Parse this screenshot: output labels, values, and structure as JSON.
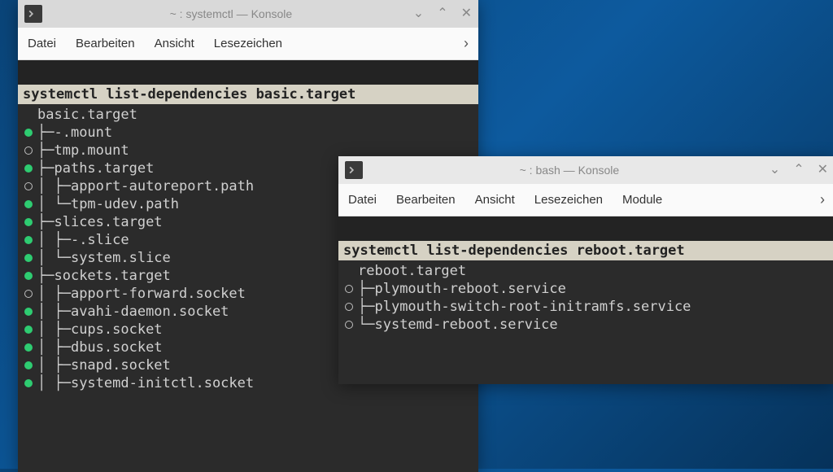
{
  "window1": {
    "title": "~ : systemctl — Konsole",
    "menu": {
      "file": "Datei",
      "edit": "Bearbeiten",
      "view": "Ansicht",
      "bookmarks": "Lesezeichen"
    },
    "command": "systemctl list-dependencies basic.target",
    "root": "basic.target",
    "rows": [
      {
        "dot": "full",
        "branch": "├─",
        "name": "-.mount"
      },
      {
        "dot": "empty",
        "branch": "├─",
        "name": "tmp.mount"
      },
      {
        "dot": "full",
        "branch": "├─",
        "name": "paths.target"
      },
      {
        "dot": "empty",
        "branch": "│ ├─",
        "name": "apport-autoreport.path"
      },
      {
        "dot": "full",
        "branch": "│ └─",
        "name": "tpm-udev.path"
      },
      {
        "dot": "full",
        "branch": "├─",
        "name": "slices.target"
      },
      {
        "dot": "full",
        "branch": "│ ├─",
        "name": "-.slice"
      },
      {
        "dot": "full",
        "branch": "│ └─",
        "name": "system.slice"
      },
      {
        "dot": "full",
        "branch": "├─",
        "name": "sockets.target"
      },
      {
        "dot": "empty",
        "branch": "│ ├─",
        "name": "apport-forward.socket"
      },
      {
        "dot": "full",
        "branch": "│ ├─",
        "name": "avahi-daemon.socket"
      },
      {
        "dot": "full",
        "branch": "│ ├─",
        "name": "cups.socket"
      },
      {
        "dot": "full",
        "branch": "│ ├─",
        "name": "dbus.socket"
      },
      {
        "dot": "full",
        "branch": "│ ├─",
        "name": "snapd.socket"
      },
      {
        "dot": "full",
        "branch": "│ ├─",
        "name": "systemd-initctl.socket"
      }
    ]
  },
  "window2": {
    "title": "~ : bash — Konsole",
    "menu": {
      "file": "Datei",
      "edit": "Bearbeiten",
      "view": "Ansicht",
      "bookmarks": "Lesezeichen",
      "module": "Module"
    },
    "command": "systemctl list-dependencies reboot.target",
    "root": "reboot.target",
    "rows": [
      {
        "dot": "empty",
        "branch": "├─",
        "name": "plymouth-reboot.service"
      },
      {
        "dot": "empty",
        "branch": "├─",
        "name": "plymouth-switch-root-initramfs.service"
      },
      {
        "dot": "empty",
        "branch": "└─",
        "name": "systemd-reboot.service"
      }
    ]
  }
}
